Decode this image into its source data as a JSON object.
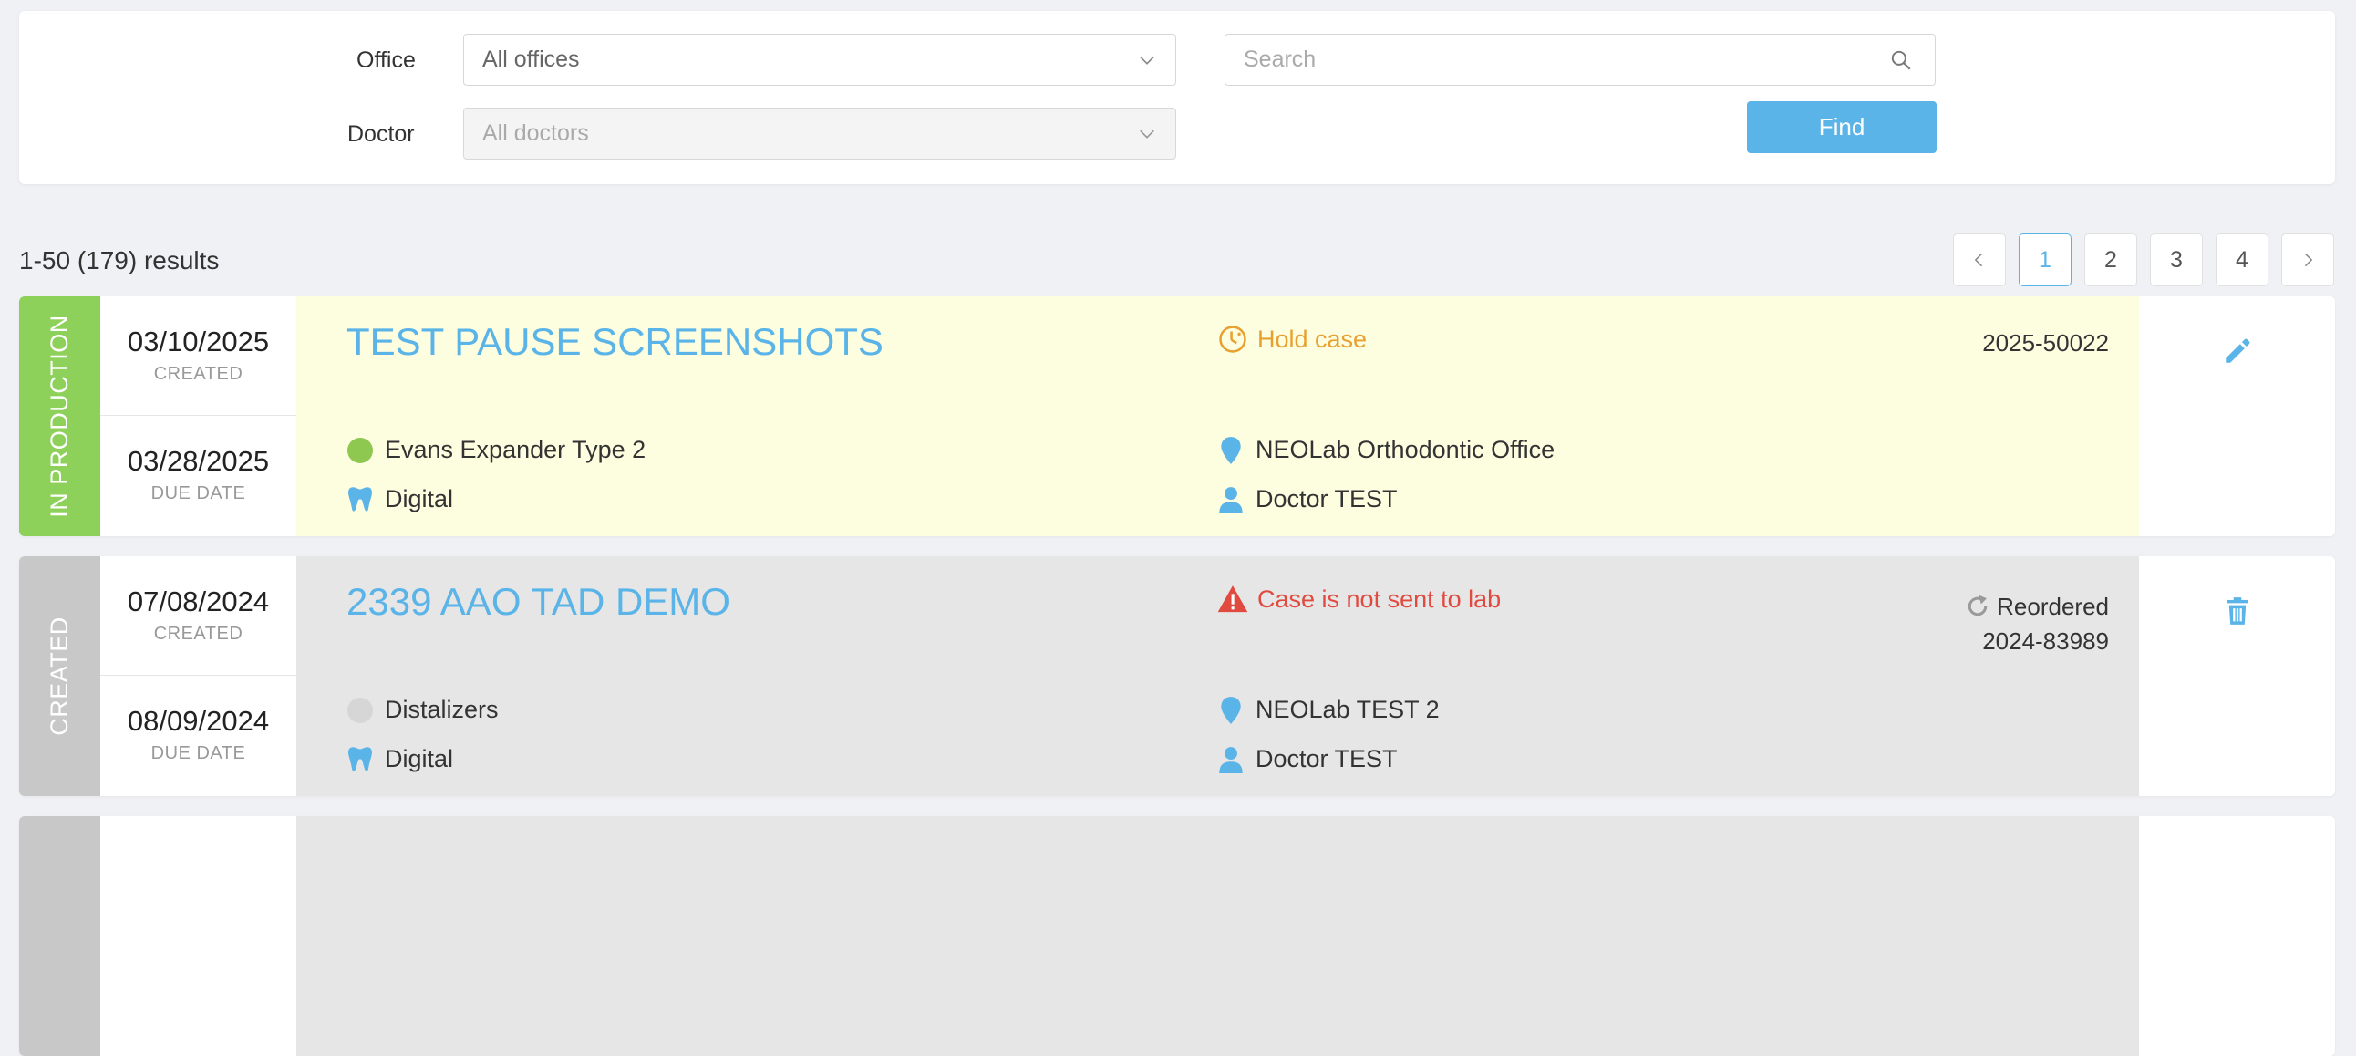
{
  "filters": {
    "office_label": "Office",
    "office_value": "All offices",
    "doctor_label": "Doctor",
    "doctor_value": "All doctors",
    "search_placeholder": "Search",
    "find_label": "Find"
  },
  "results": {
    "count_text": "1-50 (179) results",
    "pages": [
      "1",
      "2",
      "3",
      "4"
    ],
    "active_page": "1"
  },
  "colors": {
    "accent": "#5ab4e8",
    "in_production": "#8ed15a",
    "created": "#c8c8c8",
    "hold": "#e8a030",
    "error": "#e04a3f"
  },
  "cases": [
    {
      "status": "IN PRODUCTION",
      "status_color": "#8ed15a",
      "created_date": "03/10/2025",
      "created_label": "CREATED",
      "due_date": "03/28/2025",
      "due_label": "DUE DATE",
      "title": "TEST PAUSE SCREENSHOTS",
      "alert_icon": "clock-alert-icon",
      "alert_text": "Hold case",
      "alert_color": "#e8a030",
      "case_number": "2025-50022",
      "product": "Evans Expander Type 2",
      "product_dot_color": "#8ec850",
      "scan_type": "Digital",
      "office": "NEOLab Orthodontic Office",
      "doctor": "Doctor TEST",
      "background": "#fdfde0",
      "action_icon": "pencil-icon"
    },
    {
      "status": "CREATED",
      "status_color": "#c8c8c8",
      "created_date": "07/08/2024",
      "created_label": "CREATED",
      "due_date": "08/09/2024",
      "due_label": "DUE DATE",
      "title": "2339 AAO TAD DEMO",
      "alert_icon": "warning-icon",
      "alert_text": "Case is not sent to lab",
      "alert_color": "#e04a3f",
      "reordered_label": "Reordered",
      "case_number": "2024-83989",
      "product": "Distalizers",
      "product_dot_color": "#d6d6d6",
      "scan_type": "Digital",
      "office": "NEOLab TEST 2",
      "doctor": "Doctor TEST",
      "background": "#e6e6e6",
      "action_icon": "trash-icon"
    }
  ]
}
